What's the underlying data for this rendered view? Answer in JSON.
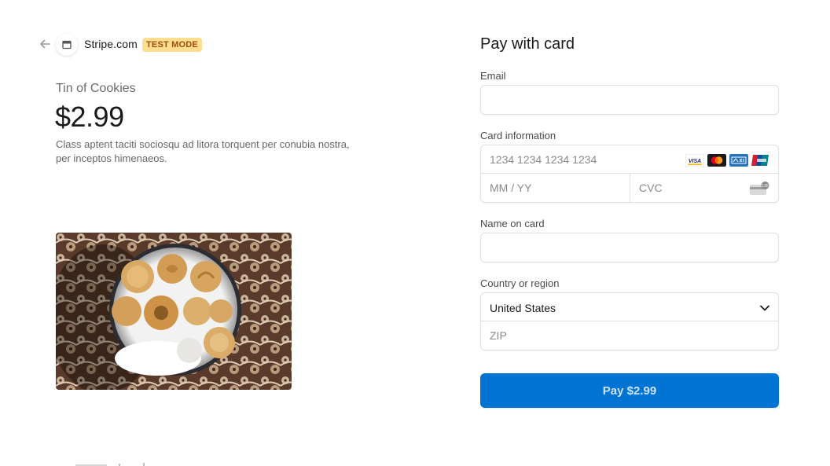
{
  "header": {
    "store_name": "Stripe.com",
    "test_badge": "TEST MODE"
  },
  "product": {
    "name": "Tin of Cookies",
    "price": "$2.99",
    "description": "Class aptent taciti sociosqu ad litora torquent per conubia nostra, per inceptos himenaeos."
  },
  "form": {
    "title": "Pay with card",
    "email_label": "Email",
    "email_value": "",
    "card_label": "Card information",
    "card_number_placeholder": "1234 1234 1234 1234",
    "expiry_placeholder": "MM / YY",
    "cvc_placeholder": "CVC",
    "card_brands": [
      "visa-icon",
      "mastercard-icon",
      "amex-icon",
      "unionpay-icon"
    ],
    "name_label": "Name on card",
    "name_value": "",
    "country_label": "Country or region",
    "country_value": "United States",
    "zip_placeholder": "ZIP",
    "pay_button": "Pay $2.99"
  },
  "colors": {
    "accent": "#0074d4",
    "badge_bg": "#ffde92",
    "badge_text": "#a04c0a"
  }
}
